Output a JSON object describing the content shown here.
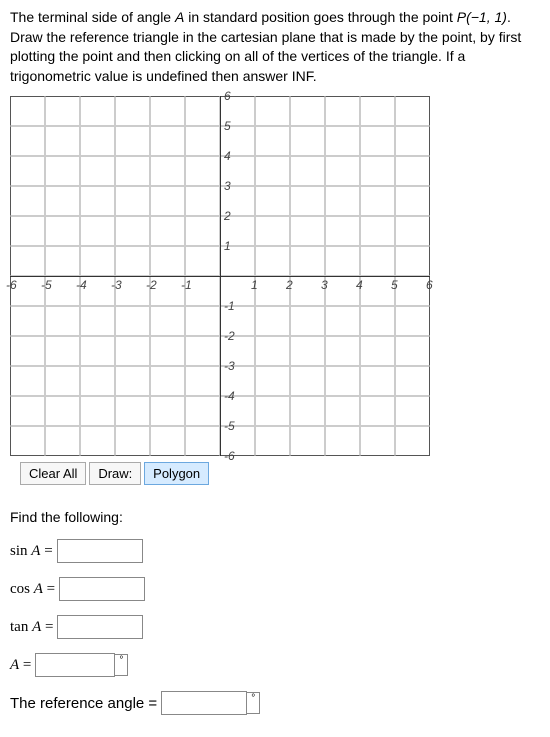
{
  "instructions": {
    "part1": "The terminal side of angle ",
    "varA": "A",
    "part2": " in standard position goes through the point ",
    "pointP": "P(−1, 1)",
    "part3": ". Draw the reference triangle in the cartesian plane that is made by the point, by first plotting the point and then clicking on all of the vertices of the triangle. If a trigonometric value is undefined then answer INF."
  },
  "chart_data": {
    "type": "scatter",
    "x": [],
    "y": [],
    "xlim": [
      -6,
      6
    ],
    "ylim": [
      -6,
      6
    ],
    "xticks": [
      -6,
      -5,
      -4,
      -3,
      -2,
      -1,
      1,
      2,
      3,
      4,
      5,
      6
    ],
    "yticks": [
      -6,
      -5,
      -4,
      -3,
      -2,
      -1,
      1,
      2,
      3,
      4,
      5,
      6
    ],
    "grid": true
  },
  "toolbar": {
    "clear_label": "Clear All",
    "draw_label": "Draw:",
    "polygon_label": "Polygon"
  },
  "prompts": {
    "find_label": "Find the following:",
    "sin_label": "sin",
    "cos_label": "cos",
    "tan_label": "tan",
    "A_eq": " = ",
    "A_only": "A",
    "ref_angle_label": "The reference angle = ",
    "degree": "°"
  },
  "values": {
    "sinA": "",
    "cosA": "",
    "tanA": "",
    "A": "",
    "refAngle": ""
  }
}
